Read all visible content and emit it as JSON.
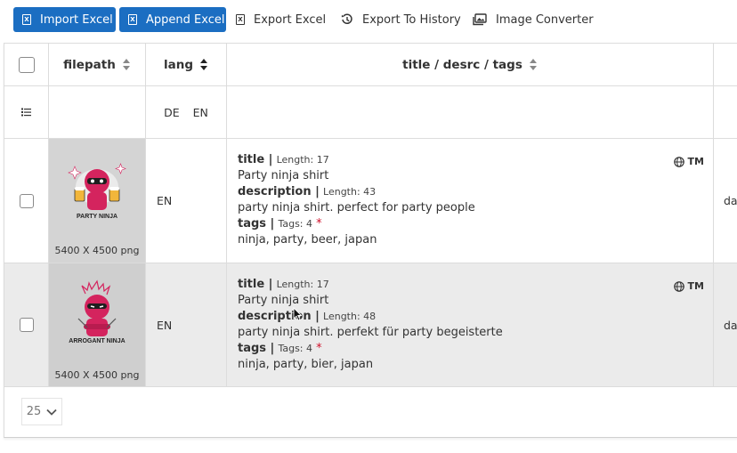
{
  "toolbar": {
    "import_excel": "Import Excel",
    "append_excel": "Append Excel",
    "export_excel": "Export Excel",
    "export_history": "Export To History",
    "image_converter": "Image Converter",
    "excel_icon_letter": "X"
  },
  "table": {
    "headers": {
      "filepath": "filepath",
      "lang": "lang",
      "meta": "title / desrc / tags"
    },
    "filter": {
      "lang_options": [
        "DE",
        "EN"
      ]
    },
    "rows": [
      {
        "image_label": "PARTY NINJA",
        "dims": "5400 X 4500 png",
        "lang": "EN",
        "title_label": "title |",
        "title_length": "Length: 17",
        "title": "Party ninja shirt",
        "desc_label": "description |",
        "desc_length": "Length: 43",
        "description": "party ninja shirt. perfect for party people",
        "tags_label": "tags |",
        "tags_count": "Tags: 4",
        "required_mark": "*",
        "tags": "ninja, party, beer, japan",
        "tm_label": "TM",
        "next_col": "da"
      },
      {
        "image_label": "ARROGANT NINJA",
        "dims": "5400 X 4500 png",
        "lang": "EN",
        "title_label": "title |",
        "title_length": "Length: 17",
        "title": "Party ninja shirt",
        "desc_label": "description |",
        "desc_length": "Length: 48",
        "description": "party ninja shirt. perfekt für party begeisterte",
        "tags_label": "tags |",
        "tags_count": "Tags: 4",
        "required_mark": "*",
        "tags": "ninja, party, bier, japan",
        "tm_label": "TM",
        "next_col": "da"
      }
    ]
  },
  "pagination": {
    "page_size": "25"
  },
  "colors": {
    "primary": "#1b6ec2",
    "required": "#d0112b",
    "ninja": "#d4245e"
  }
}
